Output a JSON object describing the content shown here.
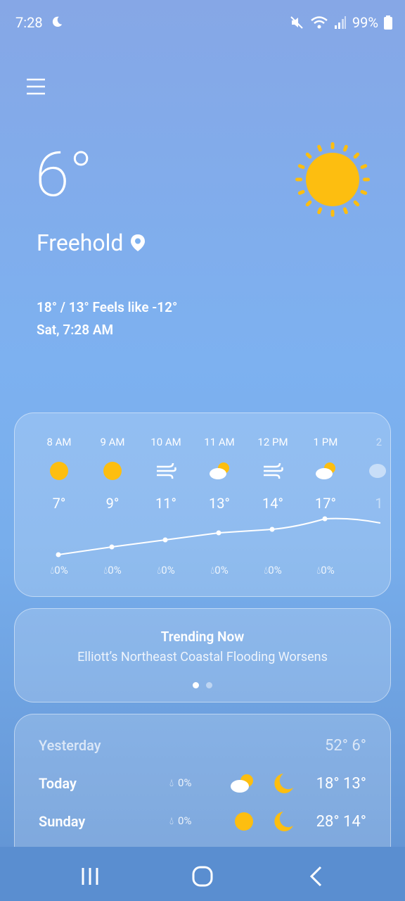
{
  "status": {
    "time": "7:28",
    "battery": "99%"
  },
  "current": {
    "temp": "6°",
    "city": "Freehold",
    "feels": "18° / 13° Feels like -12°",
    "date": "Sat, 7:28 AM"
  },
  "hourly": [
    {
      "time": "8 AM",
      "icon": "sun-icon",
      "temp": "7°",
      "precip": "0%"
    },
    {
      "time": "9 AM",
      "icon": "sun-icon",
      "temp": "9°",
      "precip": "0%"
    },
    {
      "time": "10 AM",
      "icon": "wind-icon",
      "temp": "11°",
      "precip": "0%"
    },
    {
      "time": "11 AM",
      "icon": "partly-cloudy-icon",
      "temp": "13°",
      "precip": "0%"
    },
    {
      "time": "12 PM",
      "icon": "wind-icon",
      "temp": "14°",
      "precip": "0%"
    },
    {
      "time": "1 PM",
      "icon": "partly-cloudy-icon",
      "temp": "17°",
      "precip": "0%"
    },
    {
      "time": "2",
      "icon": "partly-cloudy-icon",
      "temp": "1",
      "precip": ""
    }
  ],
  "trending": {
    "title": "Trending Now",
    "headline": "Elliott’s Northeast Coastal Flooding Worsens"
  },
  "daily": [
    {
      "day": "Yesterday",
      "temps": "52°  6°"
    },
    {
      "day": "Today",
      "precip": "0%",
      "temps": "18° 13°"
    },
    {
      "day": "Sunday",
      "precip": "0%",
      "temps": "28° 14°"
    }
  ],
  "colors": {
    "sun": "#FDBE10",
    "accent": "#ffffff"
  }
}
